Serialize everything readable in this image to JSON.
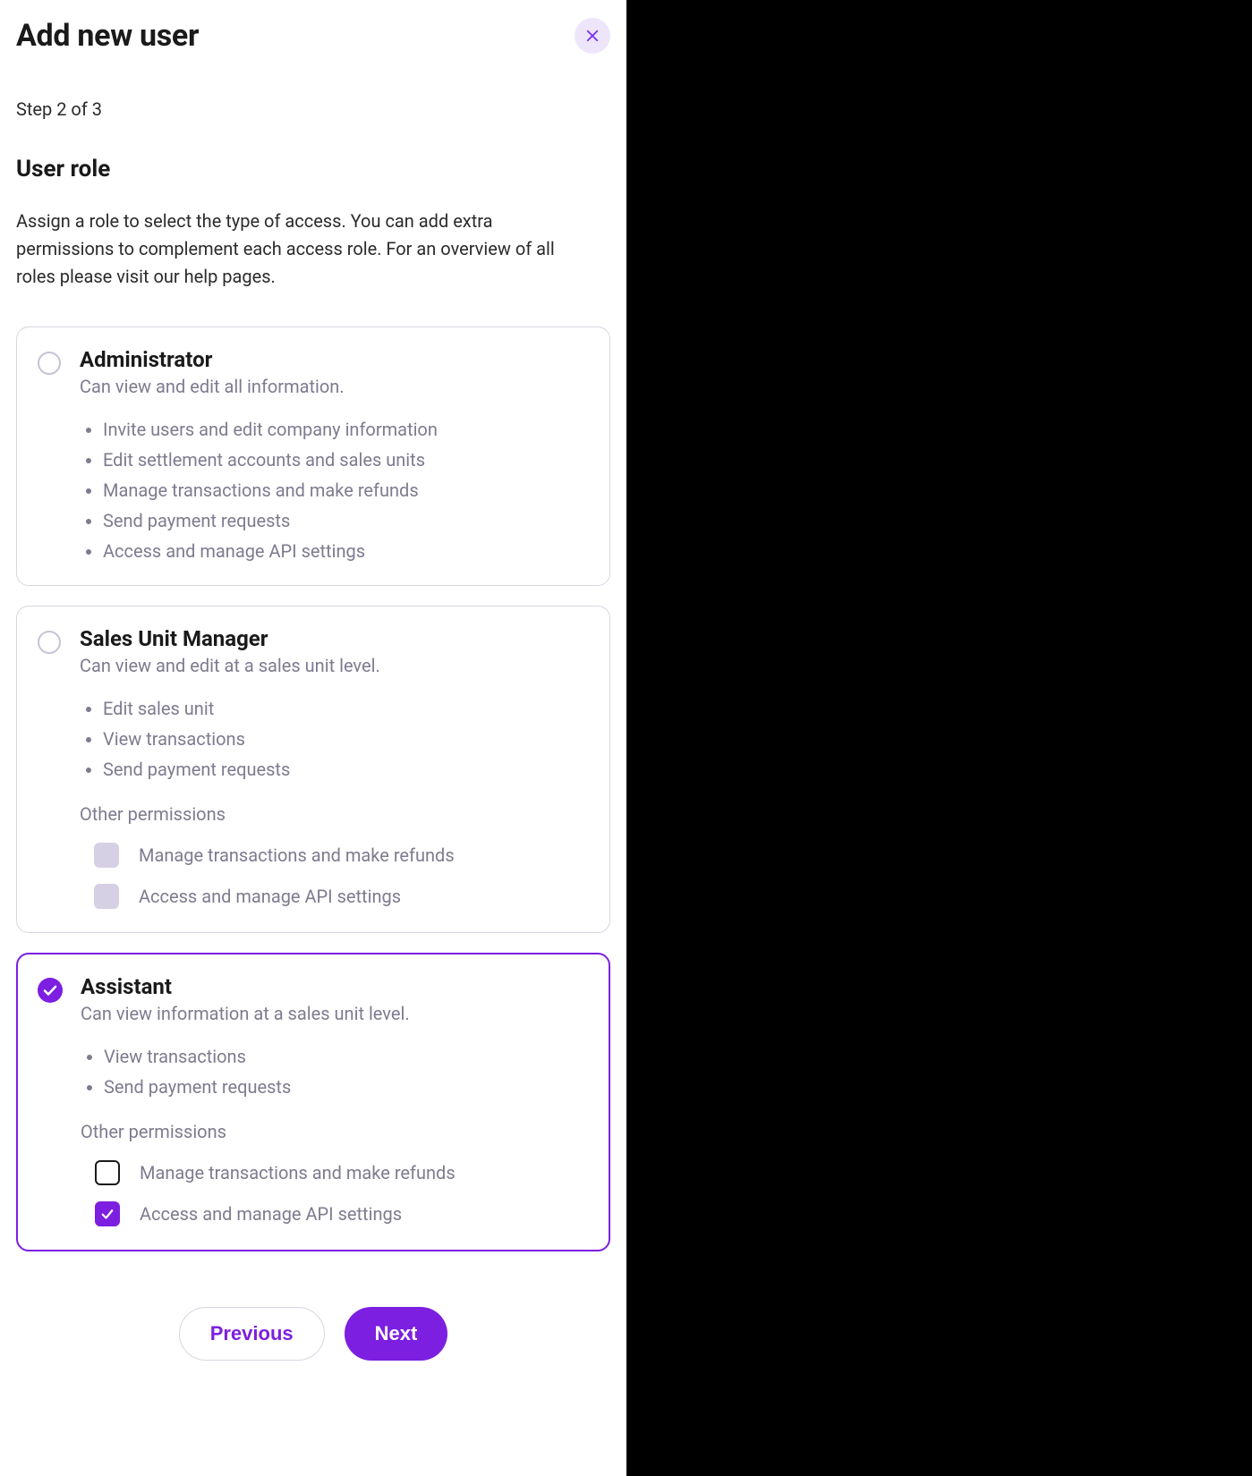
{
  "header": {
    "title": "Add new user"
  },
  "step": "Step 2 of 3",
  "section": {
    "title": "User role",
    "description": "Assign a role to select the type of access. You can add extra permissions to complement each access role. For an overview of all roles please visit our help pages."
  },
  "roles": {
    "administrator": {
      "name": "Administrator",
      "subtitle": "Can view and edit all information.",
      "selected": false,
      "bullets": [
        "Invite users and edit company information",
        "Edit settlement accounts and sales units",
        "Manage transactions and make refunds",
        "Send payment requests",
        "Access and manage API settings"
      ]
    },
    "sales_unit_manager": {
      "name": "Sales Unit Manager",
      "subtitle": "Can view and edit at a sales unit level.",
      "selected": false,
      "bullets": [
        "Edit sales unit",
        "View transactions",
        "Send payment requests"
      ],
      "other_permissions_label": "Other permissions",
      "other_permissions": [
        {
          "label": "Manage transactions and make refunds",
          "checked": false,
          "enabled": false
        },
        {
          "label": "Access and manage API settings",
          "checked": false,
          "enabled": false
        }
      ]
    },
    "assistant": {
      "name": "Assistant",
      "subtitle": "Can view information at a sales unit level.",
      "selected": true,
      "bullets": [
        "View transactions",
        "Send payment requests"
      ],
      "other_permissions_label": "Other permissions",
      "other_permissions": [
        {
          "label": "Manage transactions and make refunds",
          "checked": false,
          "enabled": true
        },
        {
          "label": "Access and manage API settings",
          "checked": true,
          "enabled": true
        }
      ]
    }
  },
  "footer": {
    "previous": "Previous",
    "next": "Next"
  }
}
